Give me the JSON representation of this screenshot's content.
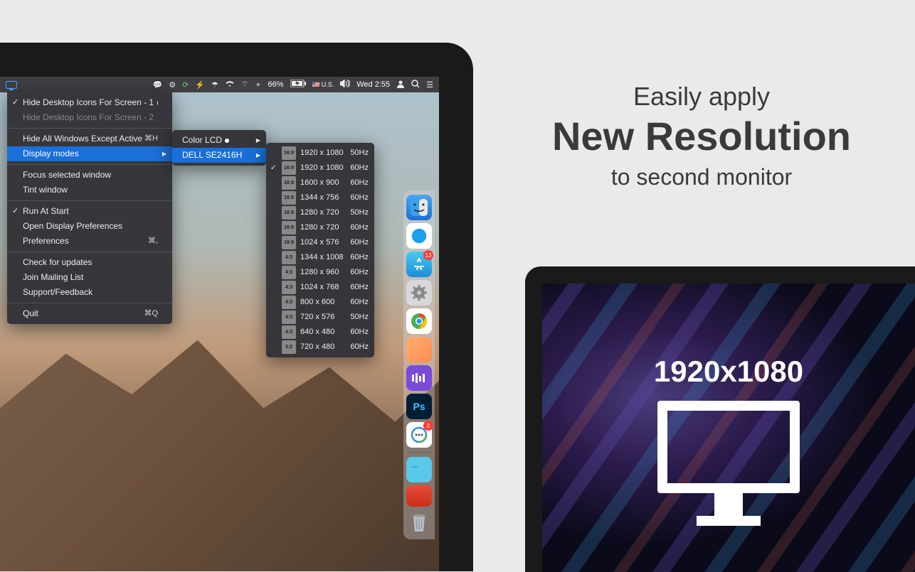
{
  "promo": {
    "l1": "Easily apply",
    "l2": "New Resolution",
    "l3": "to second monitor"
  },
  "monitor2": {
    "res": "1920x1080"
  },
  "menubar": {
    "battery": "66%",
    "locale": "U.S.",
    "clock": "Wed 2:55"
  },
  "menu": {
    "hide1": "Hide Desktop Icons For Screen - 1",
    "hide2": "Hide Desktop Icons For Screen - 2",
    "hideAll": "Hide All Windows Except Active",
    "hideAllSc": "⌘H",
    "disp": "Display modes",
    "focus": "Focus selected window",
    "tint": "Tint window",
    "run": "Run At Start",
    "openDisp": "Open Display Preferences",
    "prefs": "Preferences",
    "prefsSc": "⌘,",
    "check": "Check for updates",
    "mail": "Join Mailing List",
    "support": "Support/Feedback",
    "quit": "Quit",
    "quitSc": "⌘Q"
  },
  "sub1": {
    "a": "Color LCD",
    "b": "DELL SE2416H"
  },
  "res": [
    {
      "r": "16:9",
      "v": "1920 x 1080",
      "h": "50Hz",
      "c": false
    },
    {
      "r": "16:9",
      "v": "1920 x 1080",
      "h": "60Hz",
      "c": true
    },
    {
      "r": "16:9",
      "v": "1600 x 900",
      "h": "60Hz",
      "c": false
    },
    {
      "r": "16:9",
      "v": "1344 x 756",
      "h": "60Hz",
      "c": false
    },
    {
      "r": "16:9",
      "v": "1280 x 720",
      "h": "50Hz",
      "c": false
    },
    {
      "r": "16:9",
      "v": "1280 x 720",
      "h": "60Hz",
      "c": false
    },
    {
      "r": "16:9",
      "v": "1024 x 576",
      "h": "60Hz",
      "c": false
    },
    {
      "r": "4:3",
      "v": "1344 x 1008",
      "h": "60Hz",
      "c": false
    },
    {
      "r": "4:3",
      "v": "1280 x 960",
      "h": "60Hz",
      "c": false
    },
    {
      "r": "4:3",
      "v": "1024 x 768",
      "h": "60Hz",
      "c": false
    },
    {
      "r": "4:3",
      "v": "800 x 600",
      "h": "60Hz",
      "c": false
    },
    {
      "r": "4:3",
      "v": "720 x 576",
      "h": "50Hz",
      "c": false
    },
    {
      "r": "4:3",
      "v": "640 x 480",
      "h": "60Hz",
      "c": false
    },
    {
      "r": "3:2",
      "v": "720 x 480",
      "h": "60Hz",
      "c": false
    }
  ],
  "dock": {
    "appstore_badge": "13",
    "chat_badge": "2"
  }
}
